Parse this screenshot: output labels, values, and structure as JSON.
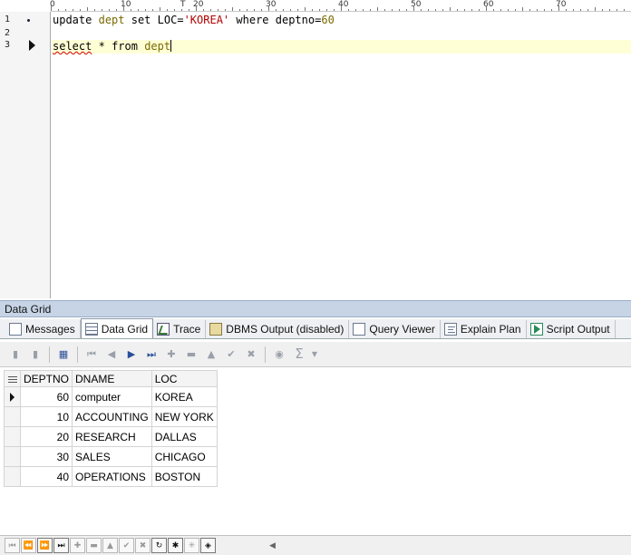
{
  "editor": {
    "ruler": {
      "labels": [
        "0",
        "10",
        "20",
        "30",
        "40",
        "50",
        "60",
        "70"
      ],
      "cursor_marker": "T"
    },
    "lines": [
      {
        "number": "1",
        "marker": "dot"
      },
      {
        "number": "2",
        "marker": "none"
      },
      {
        "number": "3",
        "marker": "arrow"
      }
    ],
    "statement1": {
      "update": "update",
      "table": "dept",
      "set": "set",
      "column": "LOC",
      "eq": "=",
      "value": "'KOREA'",
      "where": "where",
      "condition_col": "deptno",
      "condition_op": "=",
      "condition_val": "60"
    },
    "statement3": {
      "select": "select",
      "star": "*",
      "from": "from",
      "table": "dept"
    }
  },
  "panel": {
    "title": "Data Grid",
    "tabs": [
      {
        "label": "Messages",
        "icon": "messages-icon"
      },
      {
        "label": "Data Grid",
        "icon": "grid-icon",
        "active": true
      },
      {
        "label": "Trace",
        "icon": "trace-icon"
      },
      {
        "label": "DBMS Output (disabled)",
        "icon": "dbms-output-icon"
      },
      {
        "label": "Query Viewer",
        "icon": "query-viewer-icon"
      },
      {
        "label": "Explain Plan",
        "icon": "explain-plan-icon"
      },
      {
        "label": "Script Output",
        "icon": "script-output-icon"
      }
    ]
  },
  "grid": {
    "columns": [
      "DEPTNO",
      "DNAME",
      "LOC"
    ],
    "rows": [
      [
        "60",
        "computer",
        "KOREA"
      ],
      [
        "10",
        "ACCOUNTING",
        "NEW YORK"
      ],
      [
        "20",
        "RESEARCH",
        "DALLAS"
      ],
      [
        "30",
        "SALES",
        "CHICAGO"
      ],
      [
        "40",
        "OPERATIONS",
        "BOSTON"
      ]
    ],
    "current_row": 0
  },
  "colors": {
    "panel_title_bg": "#c6d4e6",
    "current_line_bg": "#ffffd6",
    "string_literal": "#b40000",
    "identifier": "#7a6a00"
  }
}
